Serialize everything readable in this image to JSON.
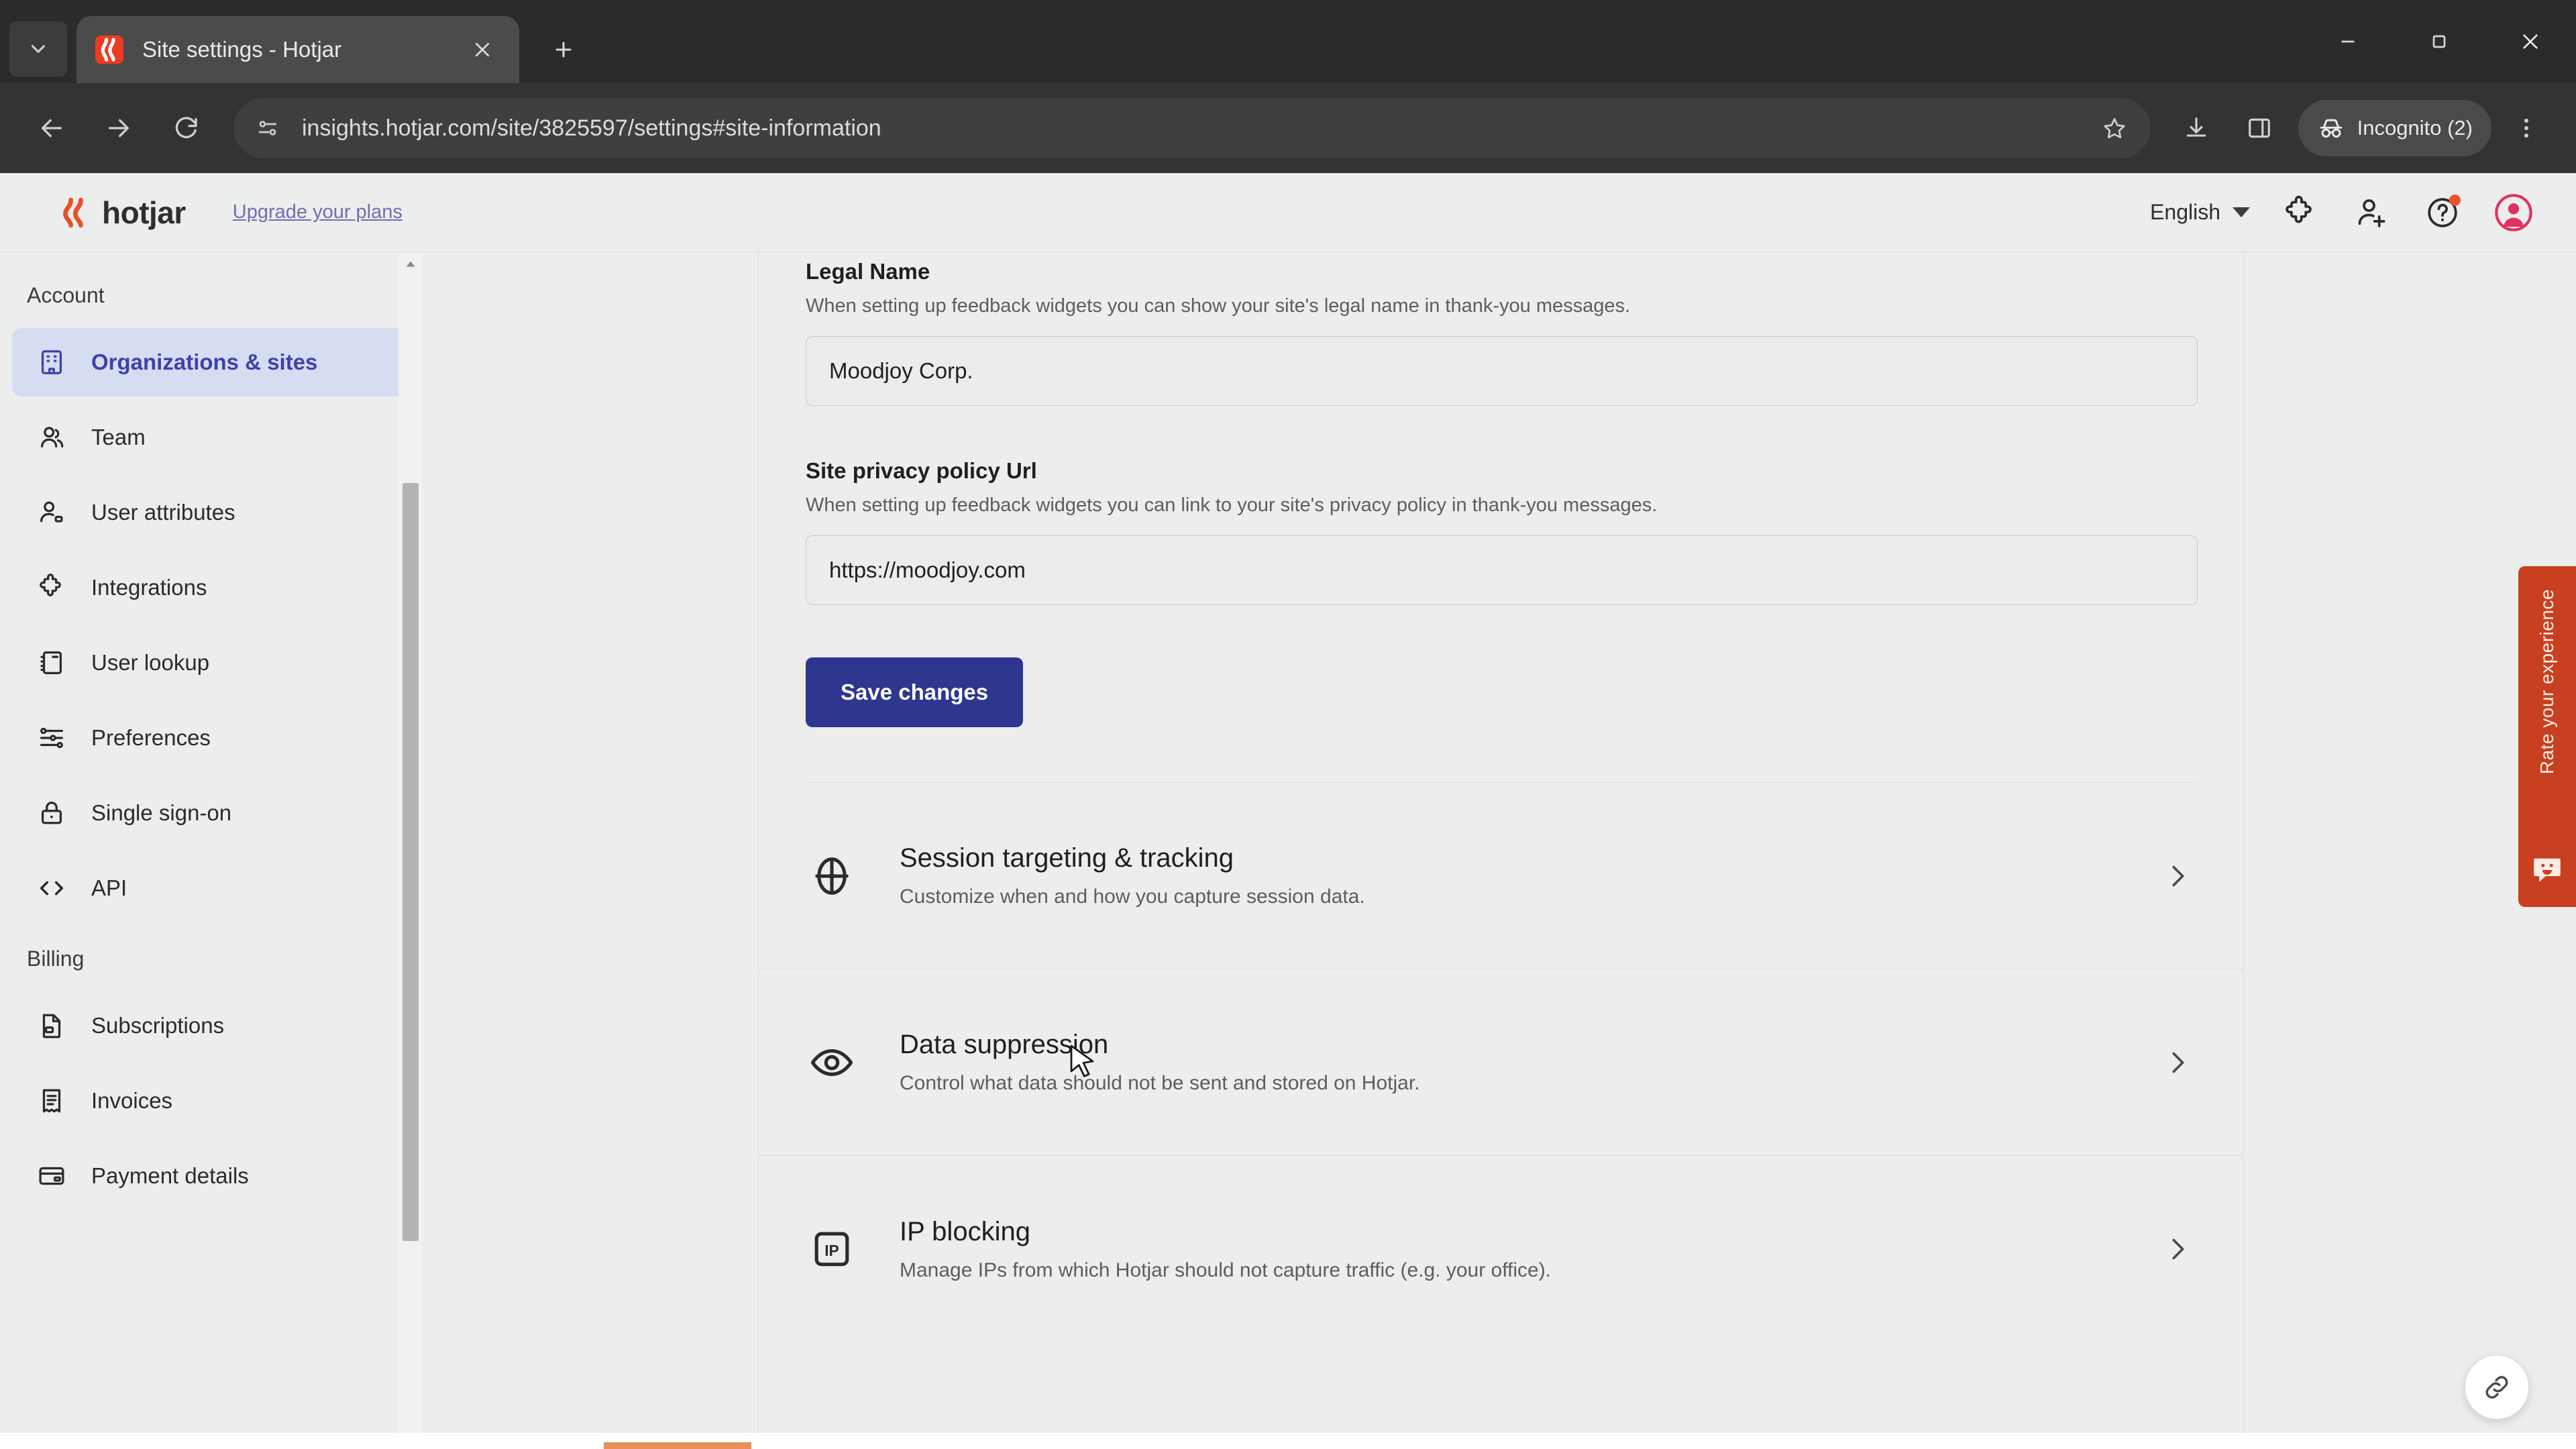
{
  "browser": {
    "tab": {
      "title": "Site settings - Hotjar",
      "favicon": "hotjar-favicon"
    },
    "tab_search_icon": "chevron-down-icon",
    "new_tab_icon": "plus-icon",
    "close_tab_icon": "close-icon",
    "window_controls": [
      "minimize-icon",
      "maximize-icon",
      "close-window-icon"
    ],
    "nav": {
      "back_icon": "back-arrow-icon",
      "forward_icon": "forward-arrow-icon",
      "reload_icon": "reload-icon"
    },
    "omnibox": {
      "site_info_icon": "site-settings-tune-icon",
      "url": "insights.hotjar.com/site/3825597/settings#site-information",
      "bookmark_icon": "star-icon"
    },
    "toolbar_icons": [
      "download-icon",
      "side-panel-icon"
    ],
    "incognito": {
      "label": "Incognito (2)",
      "icon": "incognito-hat-icon"
    },
    "menu_icon": "kebab-menu-icon"
  },
  "app": {
    "logo_word": "hotjar",
    "logo_icon": "hotjar-logo-icon",
    "upgrade_link": "Upgrade your plans",
    "language": {
      "value": "English",
      "caret_icon": "caret-down-icon"
    },
    "header_icons": [
      {
        "name": "puzzle-integrations-icon",
        "badge": false
      },
      {
        "name": "add-user-icon",
        "badge": false
      },
      {
        "name": "help-question-icon",
        "badge": true
      }
    ],
    "avatar_icon": "user-avatar-icon",
    "accent_color": "#2e3690",
    "brand_color": "#ee3a23"
  },
  "sidebar": {
    "groups": [
      {
        "title": "Account",
        "items": [
          {
            "label": "Organizations & sites",
            "icon": "building-icon",
            "active": true
          },
          {
            "label": "Team",
            "icon": "people-icon",
            "active": false
          },
          {
            "label": "User attributes",
            "icon": "user-tag-icon",
            "active": false
          },
          {
            "label": "Integrations",
            "icon": "puzzle-icon",
            "active": false
          },
          {
            "label": "User lookup",
            "icon": "notebook-icon",
            "active": false
          },
          {
            "label": "Preferences",
            "icon": "sliders-icon",
            "active": false
          },
          {
            "label": "Single sign-on",
            "icon": "lock-icon",
            "active": false
          },
          {
            "label": "API",
            "icon": "code-brackets-icon",
            "active": false
          }
        ]
      },
      {
        "title": "Billing",
        "items": [
          {
            "label": "Subscriptions",
            "icon": "document-card-icon",
            "active": false
          },
          {
            "label": "Invoices",
            "icon": "receipt-icon",
            "active": false
          },
          {
            "label": "Payment details",
            "icon": "credit-card-icon",
            "active": false
          }
        ]
      }
    ],
    "scrollbar": {
      "up_icon": "scroll-up-arrow-icon",
      "down_icon": "scroll-down-arrow-icon"
    }
  },
  "main": {
    "fields": [
      {
        "label": "Legal Name",
        "help": "When setting up feedback widgets you can show your site's legal name in thank-you messages.",
        "value": "Moodjoy Corp."
      },
      {
        "label": "Site privacy policy Url",
        "help": "When setting up feedback widgets you can link to your site's privacy policy in thank-you messages.",
        "value": "https://moodjoy.com"
      }
    ],
    "save_button": "Save changes",
    "sections": [
      {
        "title": "Session targeting & tracking",
        "desc": "Customize when and how you capture session data.",
        "icon": "crosshair-target-icon",
        "chevron": "chevron-right-icon"
      },
      {
        "title": "Data suppression",
        "desc": "Control what data should not be sent and stored on Hotjar.",
        "icon": "eye-icon",
        "chevron": "chevron-right-icon"
      },
      {
        "title": "IP blocking",
        "desc": "Manage IPs from which Hotjar should not capture traffic (e.g. your office).",
        "icon": "ip-block-icon",
        "chevron": "chevron-right-icon"
      }
    ]
  },
  "feedback_tab": {
    "label": "Rate your experience",
    "icon": "smiley-face-icon",
    "color": "#c8401f"
  },
  "link_bubble": {
    "icon": "link-chain-icon"
  }
}
